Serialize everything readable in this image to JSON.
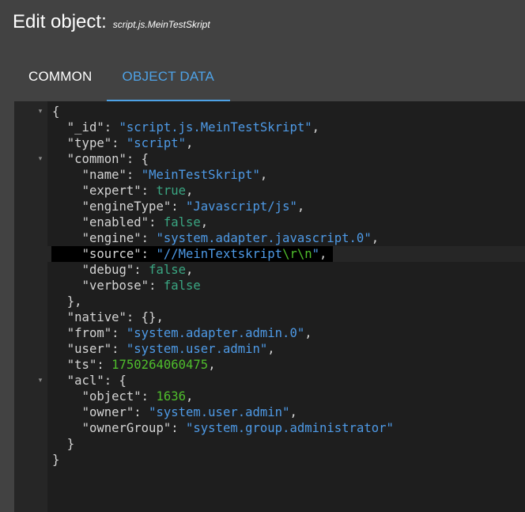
{
  "dialog": {
    "title": "Edit object:",
    "object_id": "script.js.MeinTestSkript"
  },
  "tabs": [
    {
      "label": "COMMON",
      "active": false
    },
    {
      "label": "OBJECT DATA",
      "active": true
    }
  ],
  "colors": {
    "accent": "#4ea2e6",
    "background": "#424242",
    "editor_bg": "#1e1e1e",
    "string": "#4e9ae6",
    "boolean": "#3aa682",
    "number": "#4fbe2c"
  },
  "editor": {
    "lines": [
      {
        "indent": "",
        "key": "",
        "value": "{",
        "fold": true
      },
      {
        "indent": "  ",
        "key": "_id",
        "value": "script.js.MeinTestSkript",
        "type": "string",
        "comma": true
      },
      {
        "indent": "  ",
        "key": "type",
        "value": "script",
        "type": "string",
        "comma": true
      },
      {
        "indent": "  ",
        "key": "common",
        "value": "{",
        "type": "open",
        "fold": true
      },
      {
        "indent": "    ",
        "key": "name",
        "value": "MeinTestSkript",
        "type": "string",
        "comma": true
      },
      {
        "indent": "    ",
        "key": "expert",
        "value": "true",
        "type": "boolean",
        "comma": true
      },
      {
        "indent": "    ",
        "key": "engineType",
        "value": "Javascript/js",
        "type": "string",
        "comma": true
      },
      {
        "indent": "    ",
        "key": "enabled",
        "value": "false",
        "type": "boolean",
        "comma": true
      },
      {
        "indent": "    ",
        "key": "engine",
        "value": "system.adapter.javascript.0",
        "type": "string",
        "comma": true
      },
      {
        "indent": "    ",
        "key": "source",
        "value": "//MeinTextskript",
        "escape": "\\r\\n",
        "type": "string",
        "comma": true,
        "active": true,
        "selected": true
      },
      {
        "indent": "    ",
        "key": "debug",
        "value": "false",
        "type": "boolean",
        "comma": true
      },
      {
        "indent": "    ",
        "key": "verbose",
        "value": "false",
        "type": "boolean",
        "comma": false
      },
      {
        "indent": "  ",
        "key": "",
        "value": "},",
        "type": "close"
      },
      {
        "indent": "  ",
        "key": "native",
        "value": "{},",
        "type": "raw"
      },
      {
        "indent": "  ",
        "key": "from",
        "value": "system.adapter.admin.0",
        "type": "string",
        "comma": true
      },
      {
        "indent": "  ",
        "key": "user",
        "value": "system.user.admin",
        "type": "string",
        "comma": true
      },
      {
        "indent": "  ",
        "key": "ts",
        "value": "1750264060475",
        "type": "number",
        "comma": true
      },
      {
        "indent": "  ",
        "key": "acl",
        "value": "{",
        "type": "open",
        "fold": true
      },
      {
        "indent": "    ",
        "key": "object",
        "value": "1636",
        "type": "number",
        "comma": true
      },
      {
        "indent": "    ",
        "key": "owner",
        "value": "system.user.admin",
        "type": "string",
        "comma": true
      },
      {
        "indent": "    ",
        "key": "ownerGroup",
        "value": "system.group.administrator",
        "type": "string",
        "comma": false
      },
      {
        "indent": "  ",
        "key": "",
        "value": "}",
        "type": "close"
      },
      {
        "indent": "",
        "key": "",
        "value": "}",
        "type": "close"
      }
    ]
  }
}
